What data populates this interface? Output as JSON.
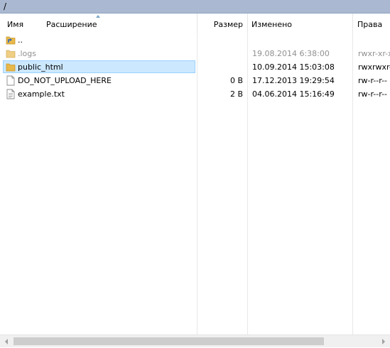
{
  "path": "/",
  "columns": {
    "name": "Имя",
    "extension": "Расширение",
    "size": "Размер",
    "modified": "Изменено",
    "permissions": "Права"
  },
  "files": [
    {
      "name": "..",
      "size": "",
      "modified": "",
      "permissions": "",
      "type": "parent-folder"
    },
    {
      "name": ".logs",
      "size": "",
      "modified": "19.08.2014 6:38:00",
      "permissions": "rwxr-xr-x",
      "type": "folder"
    },
    {
      "name": "public_html",
      "size": "",
      "modified": "10.09.2014 15:03:08",
      "permissions": "rwxrwxr-x",
      "type": "folder"
    },
    {
      "name": "DO_NOT_UPLOAD_HERE",
      "size": "0 B",
      "modified": "17.12.2013 19:29:54",
      "permissions": "rw-r--r--",
      "type": "file"
    },
    {
      "name": "example.txt",
      "size": "2 B",
      "modified": "04.06.2014 15:16:49",
      "permissions": "rw-r--r--",
      "type": "text-file"
    }
  ],
  "colors": {
    "path_bar": "#aab9d1",
    "selection_fill": "#cce8ff",
    "selection_border": "#99d1ff",
    "folder": "#e8b84a",
    "sort_arrow": "#7aa6c8"
  }
}
